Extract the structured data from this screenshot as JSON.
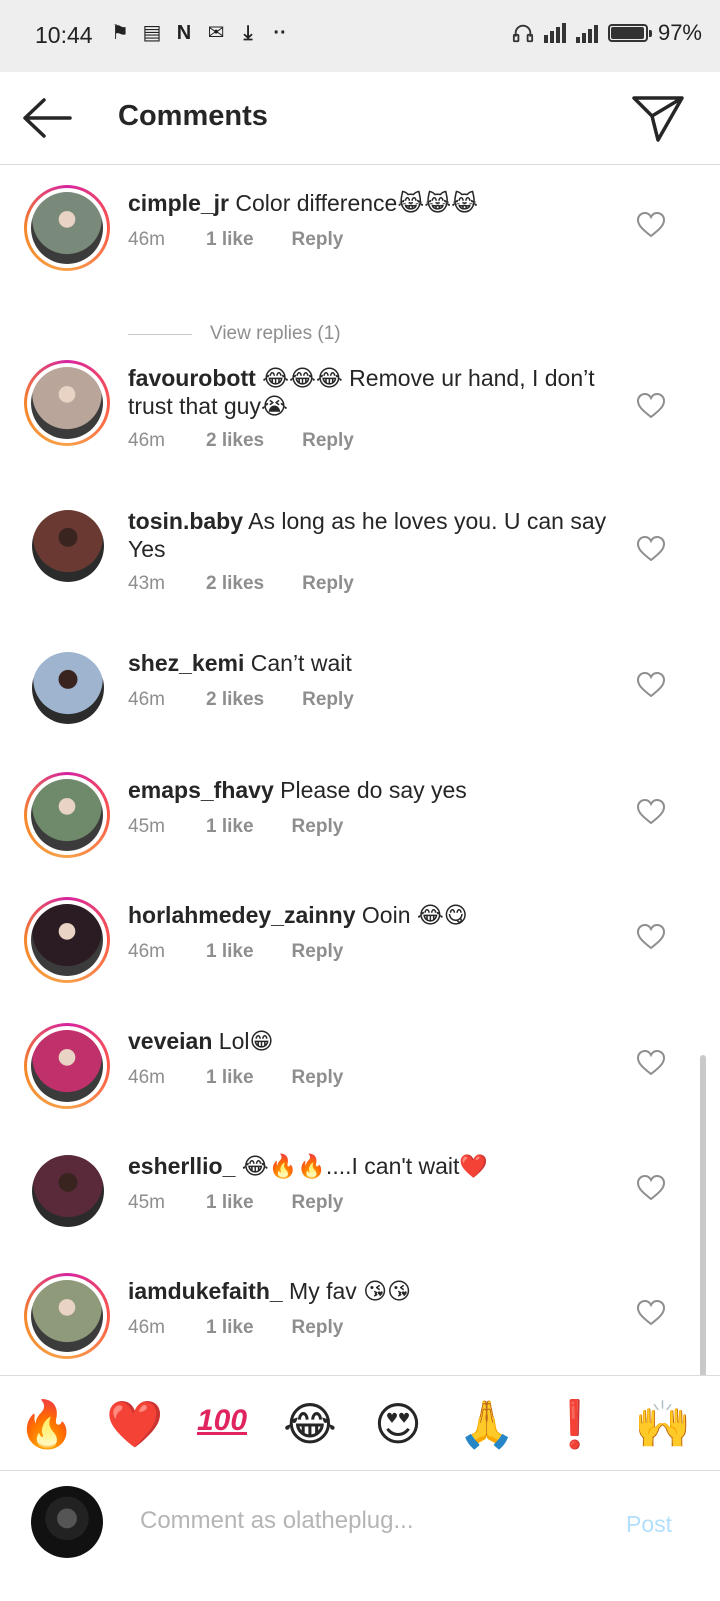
{
  "status_bar": {
    "time": "10:44",
    "notification_icons": [
      "shutter-icon",
      "message-icon",
      "n-app-icon",
      "gmail-icon",
      "download-icon",
      "more-dots-icon"
    ],
    "battery": "97%",
    "battery_level": 0.97
  },
  "header": {
    "title": "Comments",
    "back_icon": "arrow-left-icon",
    "share_icon": "paper-plane-icon"
  },
  "comments": [
    {
      "user": "cimple_jr",
      "text": " Color difference😹😹😹",
      "time": "46m",
      "likes": "1 like",
      "reply": "Reply",
      "story_ring": true,
      "avatar_color": "#7a8a7a"
    },
    {
      "user": "favourobott",
      "text": " 😂😂😂 Remove ur hand, I don’t trust that guy😭",
      "time": "46m",
      "likes": "2 likes",
      "reply": "Reply",
      "story_ring": true,
      "avatar_color": "#b9a59a"
    },
    {
      "user": "tosin.baby",
      "text": " As long as he loves you. U can say Yes",
      "time": "43m",
      "likes": "2 likes",
      "reply": "Reply",
      "story_ring": false,
      "avatar_color": "#6a3a32"
    },
    {
      "user": "shez_kemi",
      "text": " Can’t wait",
      "time": "46m",
      "likes": "2 likes",
      "reply": "Reply",
      "story_ring": false,
      "avatar_color": "#9fb4cf"
    },
    {
      "user": "emaps_fhavy",
      "text": " Please do say yes",
      "time": "45m",
      "likes": "1 like",
      "reply": "Reply",
      "story_ring": true,
      "avatar_color": "#6f8a6a"
    },
    {
      "user": "horlahmedey_zainny",
      "text": " Ooin 😂😋",
      "time": "46m",
      "likes": "1 like",
      "reply": "Reply",
      "story_ring": true,
      "avatar_color": "#2a1c22"
    },
    {
      "user": "veveian",
      "text": " Lol😁",
      "time": "46m",
      "likes": "1 like",
      "reply": "Reply",
      "story_ring": true,
      "avatar_color": "#c0306a"
    },
    {
      "user": "esherllio_",
      "text": " 😂🔥🔥....I can't wait❤️",
      "time": "45m",
      "likes": "1 like",
      "reply": "Reply",
      "story_ring": false,
      "avatar_color": "#5a2a3a"
    },
    {
      "user": "iamdukefaith_",
      "text": " My fav 😘😘",
      "time": "46m",
      "likes": "1 like",
      "reply": "Reply",
      "story_ring": true,
      "avatar_color": "#8f9a7a"
    }
  ],
  "view_replies": "View replies (1)",
  "emoji_bar": [
    "🔥",
    "❤️",
    "💯",
    "😂",
    "😍",
    "🙏",
    "❗",
    "🙌"
  ],
  "emoji_100_text": "100",
  "input": {
    "placeholder": "Comment as olatheplug...",
    "post_label": "Post"
  }
}
